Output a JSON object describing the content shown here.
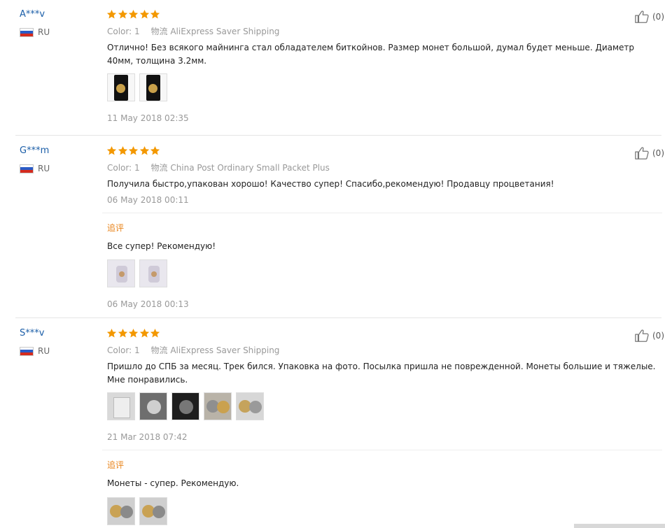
{
  "reviews": [
    {
      "user": "A***v",
      "country": "RU",
      "meta": {
        "color_label": "Color:",
        "color_value": "1",
        "logistics_label": "物流",
        "shipping": "AliExpress Saver Shipping"
      },
      "text": "Отлично! Без всякого майнинга стал обладателем биткойнов. Размер монет большой, думал будет меньше. Диаметр 40мм, толщина 3.2мм.",
      "photos": [
        "coin-photo-dark",
        "coin-photo-dark"
      ],
      "date": "11 May 2018 02:35",
      "helpful": "(0)"
    },
    {
      "user": "G***m",
      "country": "RU",
      "meta": {
        "color_label": "Color:",
        "color_value": "1",
        "logistics_label": "物流",
        "shipping": "China Post Ordinary Small Packet Plus"
      },
      "text": "Получила быстро,упакован хорошо! Качество супер! Спасибо,рекомендую! Продавцу процветания!",
      "date": "06 May 2018 00:11",
      "followup": {
        "label": "追评",
        "text": "Все супер! Рекомендую!",
        "photos": [
          "coin-photo-light",
          "coin-photo-light"
        ],
        "date": "06 May 2018 00:13"
      },
      "helpful": "(0)"
    },
    {
      "user": "S***v",
      "country": "RU",
      "meta": {
        "color_label": "Color:",
        "color_value": "1",
        "logistics_label": "物流",
        "shipping": "AliExpress Saver Shipping"
      },
      "text": "Пришло до СПБ за месяц. Трек бился. Упаковка на фото. Посылка пришла не поврежденной. Монеты большие и тяжелые. Мне понравились.",
      "photos": [
        "package-photo",
        "coin-photo-silver",
        "coin-photo-black",
        "coin-photo-gold",
        "coin-photo-silver-gold"
      ],
      "date": "21 Mar 2018 07:42",
      "followup": {
        "label": "追评",
        "text": "Монеты - супер. Рекомендую.",
        "photos": [
          "coins-pair-photo",
          "coins-pair-photo"
        ]
      },
      "helpful": "(0)"
    }
  ],
  "colors": {
    "username": "#1b5ea8",
    "star": "#f39800",
    "followup_label": "#e8841b",
    "meta_text": "#999999"
  },
  "icons": {
    "flag": "russia-flag-icon",
    "star": "star-icon",
    "helpful": "thumbs-up-icon"
  }
}
